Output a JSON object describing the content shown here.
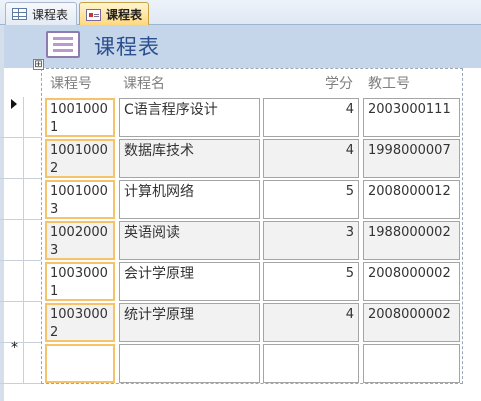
{
  "tabs": [
    {
      "label": "课程表",
      "icon": "table-icon",
      "active": false
    },
    {
      "label": "课程表",
      "icon": "form-icon",
      "active": true
    }
  ],
  "form": {
    "title": "课程表",
    "move_handle": "⊞"
  },
  "columns": [
    "课程号",
    "课程名",
    "学分",
    "教工号"
  ],
  "rows": [
    {
      "course_id": "10010001",
      "course_id_display": "1001000\n1",
      "name": "C语言程序设计",
      "credits": "4",
      "teacher_id": "2003000111"
    },
    {
      "course_id": "10010002",
      "course_id_display": "1001000\n2",
      "name": "数据库技术",
      "credits": "4",
      "teacher_id": "1998000007"
    },
    {
      "course_id": "10010003",
      "course_id_display": "1001000\n3",
      "name": "计算机网络",
      "credits": "5",
      "teacher_id": "2008000012"
    },
    {
      "course_id": "10020003",
      "course_id_display": "1002000\n3",
      "name": "英语阅读",
      "credits": "3",
      "teacher_id": "1988000002"
    },
    {
      "course_id": "10030001",
      "course_id_display": "1003000\n1",
      "name": "会计学原理",
      "credits": "5",
      "teacher_id": "2008000002"
    },
    {
      "course_id": "10030002",
      "course_id_display": "1003000\n2",
      "name": "统计学原理",
      "credits": "4",
      "teacher_id": "2008000002"
    }
  ],
  "new_record_marker": "*",
  "colors": {
    "header_band": "#c5d5ea",
    "title": "#2b4f8f",
    "active_tab": "#ffd77a",
    "focus_border": "#f6c26a"
  }
}
